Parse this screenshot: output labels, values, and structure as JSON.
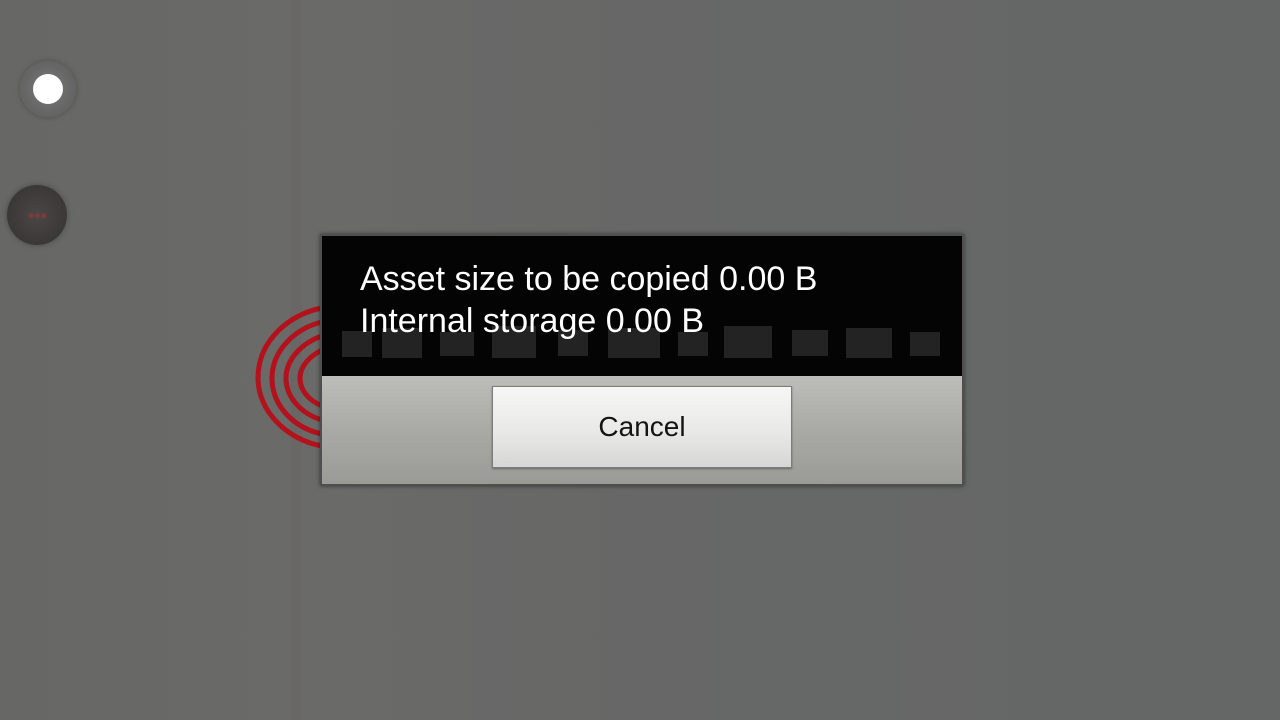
{
  "background": {
    "color": "#686867",
    "left_controls": [
      {
        "icon": "record-indicator-icon",
        "color": "#ffffff"
      },
      {
        "icon": "stop-indicator-icon",
        "color": "#3a3837"
      }
    ],
    "decoration_icon": "fingerprint-icon",
    "accent_color": "#b3121c"
  },
  "dialog": {
    "message_lines": [
      "Asset size to be copied 0.00 B",
      "Internal storage 0.00 B"
    ],
    "cancel_label": "Cancel",
    "body_color": "#040404",
    "footer_color": "#aaaaa6"
  }
}
